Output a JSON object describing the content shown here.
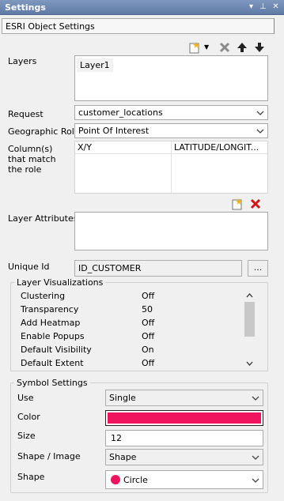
{
  "panel": {
    "title": "Settings"
  },
  "object_tab": {
    "label": "ESRI Object Settings"
  },
  "layers": {
    "label": "Layers",
    "items": [
      "Layer1"
    ]
  },
  "request": {
    "label": "Request",
    "value": "customer_locations"
  },
  "geo_role": {
    "label": "Geographic Role",
    "value": "Point Of Interest"
  },
  "columns": {
    "label": "Column(s) that match the role",
    "left": "X/Y",
    "right": "LATITUDE/LONGIT..."
  },
  "layer_attributes": {
    "label": "Layer Attributes"
  },
  "unique_id": {
    "label": "Unique Id",
    "value": "ID_CUSTOMER",
    "browse": "..."
  },
  "layer_vis": {
    "title": "Layer Visualizations",
    "rows": [
      {
        "name": "Clustering",
        "value": "Off"
      },
      {
        "name": "Transparency",
        "value": "50"
      },
      {
        "name": "Add Heatmap",
        "value": "Off"
      },
      {
        "name": "Enable Popups",
        "value": "Off"
      },
      {
        "name": "Default Visibility",
        "value": "On"
      },
      {
        "name": "Default Extent",
        "value": "Off"
      }
    ]
  },
  "symbol": {
    "title": "Symbol Settings",
    "use_label": "Use",
    "use_value": "Single",
    "color_label": "Color",
    "color_value": "#f0145f",
    "size_label": "Size",
    "size_value": "12",
    "shape_image_label": "Shape / Image",
    "shape_image_value": "Shape",
    "shape_label": "Shape",
    "shape_value": "Circle"
  },
  "icons": {
    "new": "new-layer-icon",
    "delete": "delete-layer-icon",
    "up": "move-up-icon",
    "down": "move-down-icon"
  }
}
